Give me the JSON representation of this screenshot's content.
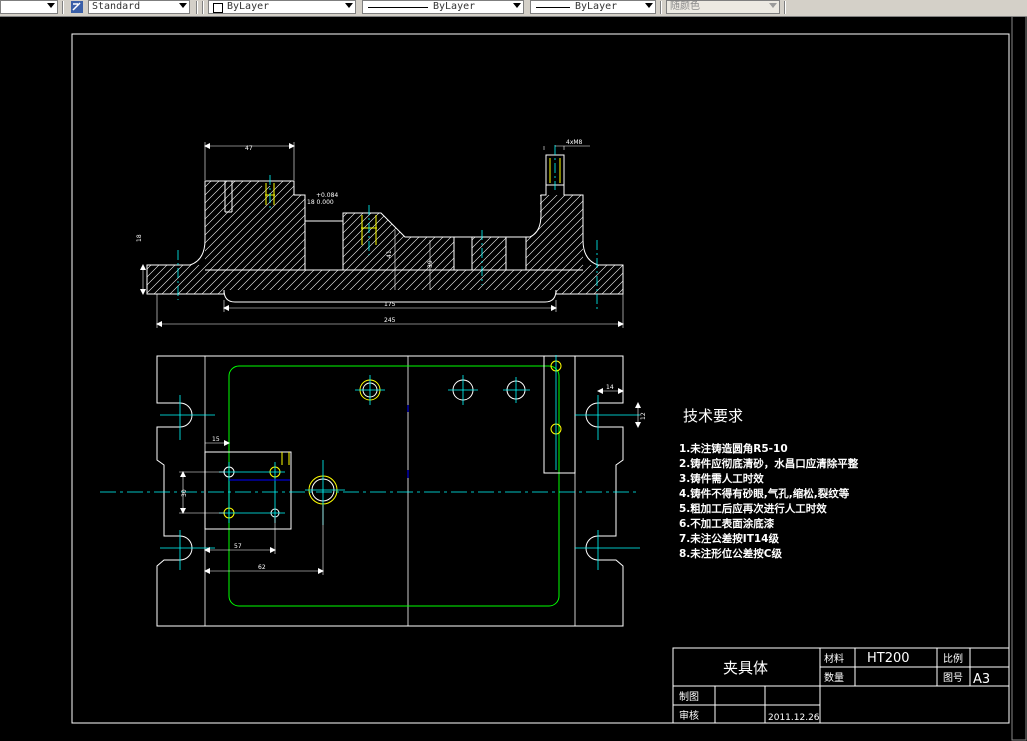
{
  "toolbar": {
    "text_style": "Standard",
    "layer": "ByLayer",
    "linetype": "ByLayer",
    "lineweight": "ByLayer",
    "color": "随颜色"
  },
  "colors": {
    "background": "#000000",
    "outline": "#ffffff",
    "cyan": "#00ffff",
    "green": "#00ff00",
    "yellow": "#ffff00",
    "blue": "#0000ff"
  },
  "drawing": {
    "dimensions": {
      "d47": "47",
      "tol_plus": "+0.084",
      "tol_base": "18  0.000",
      "top_right": "4xM8",
      "d175": "175",
      "d245": "245",
      "d18": "18",
      "d15": "15",
      "d30": "30",
      "d57": "57",
      "d62": "62",
      "d14": "14",
      "d12": "12",
      "d41": "41",
      "d39": "39"
    },
    "requirements": {
      "title": "技术要求",
      "items": [
        "1.未注铸造圆角R5-10",
        "2.铸件应彻底清砂，水昌口应清除平整",
        "3.铸件需人工时效",
        "4.铸件不得有砂眼,气孔,缩松,裂纹等",
        "5.粗加工后应再次进行人工时效",
        "6.不加工表面涂底漆",
        "7.未注公差按IT14级",
        "8.未注形位公差按C级"
      ]
    },
    "title_block": {
      "part_name": "夹具体",
      "material_label": "材料",
      "material": "HT200",
      "scale_label": "比例",
      "quantity_label": "数量",
      "drawing_no_label": "图号",
      "drawing_no": "A3",
      "drafter_label": "制图",
      "reviewer_label": "审核",
      "date": "2011.12.26"
    }
  }
}
